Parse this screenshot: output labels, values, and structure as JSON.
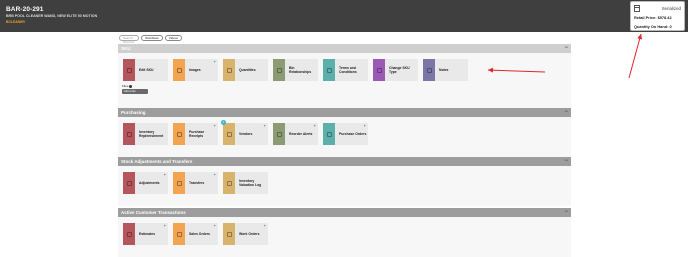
{
  "header": {
    "sku_id": "BAR-20-291",
    "description": "BRB POOL CLEANER WAND, NEW ELITE 50 MOTION",
    "tag": "BCLEANER",
    "status": "Serialized",
    "retail_price": "Retail Price: $578.42",
    "qty_on_hand": "Quantity On Hand: 0"
  },
  "pills": {
    "search_placeholder": "Search Shortcut",
    "workflows": "Workflows",
    "videos": "Videos"
  },
  "sections": {
    "sku": {
      "title": "SKU",
      "tiles": [
        {
          "label": "Edit SKU",
          "color": "#b5565c",
          "plus": false
        },
        {
          "label": "Images",
          "color": "#f2a451",
          "plus": true
        },
        {
          "label": "Quantities",
          "color": "#d8b36c",
          "plus": false
        },
        {
          "label": "Bin Relationships",
          "color": "#8c9b74",
          "plus": false
        },
        {
          "label": "Terms and Conditions",
          "color": "#5bb0ac",
          "plus": false
        },
        {
          "label": "Change SKU Type",
          "color": "#9b59b6",
          "plus": false
        },
        {
          "label": "Notes",
          "color": "#7a76a6",
          "plus": false
        }
      ],
      "files_label": "Files",
      "add_file": "Add a File"
    },
    "purchasing": {
      "title": "Purchasing",
      "tiles": [
        {
          "label": "Inventory Replenishment",
          "color": "#b5565c",
          "plus": false,
          "badge": ""
        },
        {
          "label": "Purchase Receipts",
          "color": "#f2a451",
          "plus": true,
          "badge": ""
        },
        {
          "label": "Vendors",
          "color": "#d8b36c",
          "plus": true,
          "badge": "1"
        },
        {
          "label": "Reorder Alerts",
          "color": "#8c9b74",
          "plus": true,
          "badge": ""
        },
        {
          "label": "Purchase Orders",
          "color": "#5bb0ac",
          "plus": true,
          "badge": ""
        }
      ]
    },
    "stock": {
      "title": "Stock Adjustments and Transfers",
      "tiles": [
        {
          "label": "Adjustments",
          "color": "#b5565c",
          "plus": true
        },
        {
          "label": "Transfers",
          "color": "#f2a451",
          "plus": true
        },
        {
          "label": "Inventory Valuation Log",
          "color": "#d8b36c",
          "plus": false
        }
      ]
    },
    "customer": {
      "title": "Active Customer Transactions",
      "tiles": [
        {
          "label": "Estimates",
          "color": "#b5565c",
          "plus": true
        },
        {
          "label": "Sales Orders",
          "color": "#f2a451",
          "plus": true
        },
        {
          "label": "Work Orders",
          "color": "#d8b36c",
          "plus": true
        }
      ]
    }
  },
  "annotation_color": "#e0262a"
}
